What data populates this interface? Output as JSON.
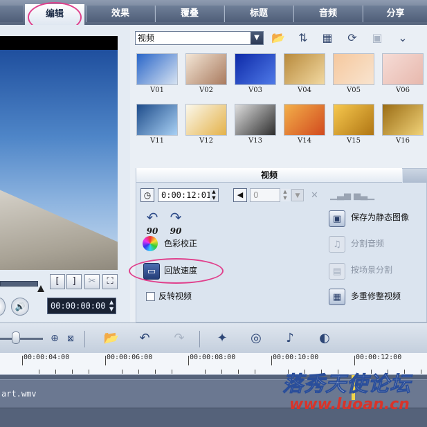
{
  "tabs": [
    "编辑",
    "效果",
    "覆叠",
    "标题",
    "音频",
    "分享"
  ],
  "active_tab_index": 0,
  "preview": {
    "timecode": "00:00:00:00",
    "mark_in_label": "[",
    "mark_out_label": "]"
  },
  "library": {
    "category": "视频",
    "thumbnails": [
      {
        "label": "V01",
        "colors": [
          "#2a66c8",
          "#d7e3f2"
        ]
      },
      {
        "label": "V02",
        "colors": [
          "#f3e6d6",
          "#a97a5e"
        ]
      },
      {
        "label": "V03",
        "colors": [
          "#0e2aa8",
          "#4f7ae8"
        ]
      },
      {
        "label": "V04",
        "colors": [
          "#b88a3c",
          "#f2d9a2"
        ]
      },
      {
        "label": "V05",
        "colors": [
          "#f6c89e",
          "#f8e4cf"
        ]
      },
      {
        "label": "V06",
        "colors": [
          "#f6dcd6",
          "#e7b8ad"
        ]
      },
      {
        "label": "V11",
        "colors": [
          "#1e4c8a",
          "#a8d0f4"
        ]
      },
      {
        "label": "V12",
        "colors": [
          "#fbf8ec",
          "#e4b24a"
        ]
      },
      {
        "label": "V13",
        "colors": [
          "#dedede",
          "#2d2d2d"
        ]
      },
      {
        "label": "V14",
        "colors": [
          "#f3b04a",
          "#d24a1e"
        ]
      },
      {
        "label": "V15",
        "colors": [
          "#f7c84e",
          "#b07614"
        ]
      },
      {
        "label": "V16",
        "colors": [
          "#9a6c14",
          "#f0d278"
        ]
      }
    ]
  },
  "options": {
    "tab_label": "视频",
    "duration": "0:00:12:01",
    "volume": "0",
    "rotate_left_label": "90",
    "rotate_right_label": "90",
    "color_correction": "色彩校正",
    "playback_speed": "回放速度",
    "reverse_video": "反转视频",
    "save_still": "保存为静态图像",
    "split_audio": "分割音频",
    "split_by_scene": "按场景分割",
    "multi_trim": "多重修整视频"
  },
  "timeline": {
    "ticks": [
      "00:00:04:00",
      "00:00:06:00",
      "00:00:08:00",
      "00:00:10:00",
      "00:00:12:00"
    ],
    "clip_name": "art.wmv"
  },
  "watermark": {
    "title": "落秀天使论坛",
    "url": "www.luoan.cn"
  },
  "colors": {
    "highlight": "#e0408c",
    "tab_bar": "#6d7b93",
    "track": "#55627a"
  }
}
